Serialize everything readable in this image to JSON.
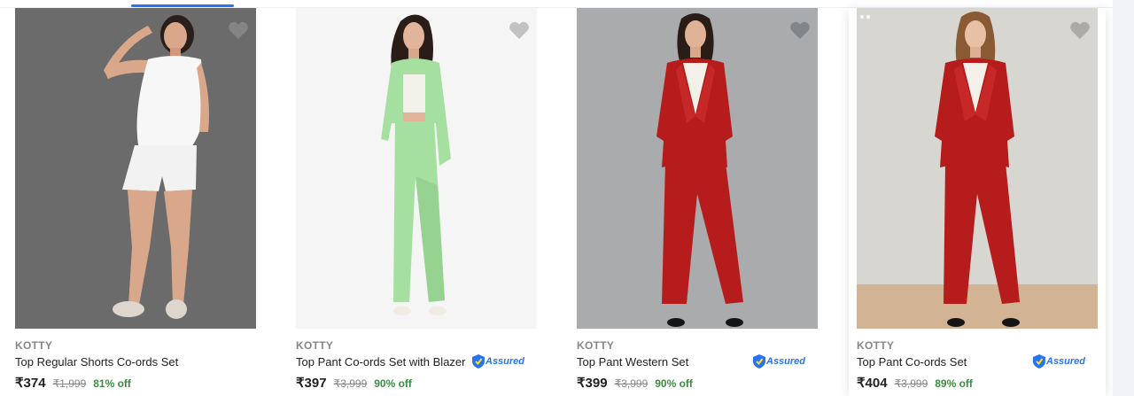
{
  "products": [
    {
      "brand": "KOTTY",
      "title": "Top Regular Shorts Co-ords Set",
      "price": "₹374",
      "mrp": "₹1,999",
      "discount": "81% off",
      "assured": false,
      "image": {
        "background": "#6b6b6b",
        "outfit": "white top and shorts"
      }
    },
    {
      "brand": "KOTTY",
      "title": "Top Pant Co-ords Set with Blazer",
      "price": "₹397",
      "mrp": "₹3,999",
      "discount": "90% off",
      "assured": true,
      "assured_label": "Assured",
      "image": {
        "background": "#f5f5f5",
        "outfit": "mint green blazer and pants"
      }
    },
    {
      "brand": "KOTTY",
      "title": "Top Pant Western Set",
      "price": "₹399",
      "mrp": "₹3,999",
      "discount": "90% off",
      "assured": true,
      "assured_label": "Assured",
      "image": {
        "background": "#a9abad",
        "outfit": "red blazer and pants"
      }
    },
    {
      "brand": "KOTTY",
      "title": "Top Pant Co-ords Set",
      "price": "₹404",
      "mrp": "₹3,999",
      "discount": "89% off",
      "assured": true,
      "assured_label": "Assured",
      "image": {
        "background": "#d8d6d1",
        "outfit": "red blazer and pants"
      }
    }
  ],
  "colors": {
    "accent": "#2874f0",
    "discount_green": "#388e3c",
    "muted_text": "#878787",
    "wishlist_heart": "#c2c2c2"
  }
}
